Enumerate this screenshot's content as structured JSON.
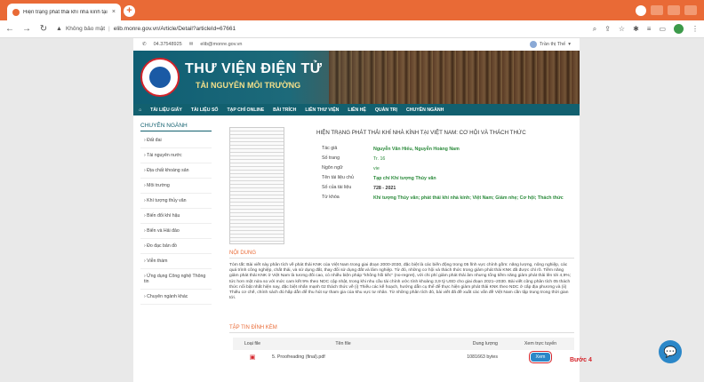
{
  "browser": {
    "tab_title": "Hiện trạng phát thải khí nhà kính tại V",
    "tab_close": "×",
    "new_tab": "+",
    "url_security": "Không bảo mật",
    "url_path": "elib.monre.gov.vn/Article/Detail?articleId=67661"
  },
  "topline": {
    "phone": "04.37548925",
    "email": "elib@monre.gov.vn",
    "user": "Trần thị Thế"
  },
  "banner": {
    "title": "THƯ VIỆN ĐIỆN TỬ",
    "subtitle": "TÀI NGUYÊN MÔI TRƯỜNG"
  },
  "nav": [
    "TÀI LIỆU GIẤY",
    "TÀI LIỆU SỐ",
    "TẠP CHÍ ONLINE",
    "BÀI TRÍCH",
    "LIÊN THƯ VIỆN",
    "LIÊN HỆ",
    "QUẢN TRỊ",
    "CHUYÊN NGÀNH"
  ],
  "sidebar": {
    "title": "CHUYÊN NGÀNH",
    "items": [
      "Đất đai",
      "Tài nguyên nước",
      "Địa chất khoáng sản",
      "Môi trường",
      "Khí tượng thủy văn",
      "Biến đổi khí hậu",
      "Biển và Hải đảo",
      "Đo đạc bản đồ",
      "Viễn thám",
      "Ứng dụng Công nghệ Thông tin",
      "Chuyên ngành khác"
    ]
  },
  "doc": {
    "title": "HIỆN TRẠNG PHÁT THẢI KHÍ NHÀ KÍNH TẠI VIỆT NAM: CƠ HỘI VÀ THÁCH THỨC",
    "meta": [
      {
        "k": "Tác giả",
        "v": "Nguyễn Văn Hiếu, Nguyễn Hoàng Nam"
      },
      {
        "k": "Số trang",
        "v": "Tr. 16"
      },
      {
        "k": "Ngôn ngữ",
        "v": "vie"
      },
      {
        "k": "Tên tài liệu chủ",
        "v": "Tạp chí Khí tượng Thủy văn"
      },
      {
        "k": "Số của tài liệu",
        "v": "728 - 2021"
      },
      {
        "k": "Từ khóa",
        "v": "Khí tượng Thủy văn; phát thải khí nhà kính; Việt Nam; Giảm nhẹ; Cơ hội; Thách thức"
      }
    ]
  },
  "content_heading": "NỘI DUNG",
  "abstract": "Tóm tắt: Bài viết này phân tích về phát thải KNK của Việt Nam trong giai đoạn 2000-2030, đặc biệt là các biến động trong 05 lĩnh vực chính gồm: năng lượng, nông nghiệp, các quá trình công nghiệp, chất thải, và sử dụng đất, thay đổi sử dụng đất và lâm nghiệp. Từ đó, những cơ hội và thách thức trong giảm phát thải KNK đã được chỉ rõ. Tiềm năng giảm phát thải KNK ở Việt Nam là tương đối cao, có nhiều biện pháp \"không hối tiếc\" (no-regret), với chi phí giảm phát thải âm nhưng tổng tiềm năng giảm phát thải lên tới 4,9%; tức hơn một nửa so với mức cam kết 9% theo NDC cập nhật, trong khi nhu cầu tài chính ước tính khoảng 3,9 tỷ USD cho giai đoạn 2021–2030. Bài viết cũng phân tích 05 thách thức nổi bật nhất hiện nay, đặc biệt nhấn mạnh 02 thách thức về (i) Thiếu các kế hoạch, hướng dẫn cụ thể để thực hiện giảm phát thải KNK theo NDC ở cấp địa phương và (ii) Thiếu cơ chế, chính sách đủ hấp dẫn để thu hút sự tham gia của khu vực tư nhân. Từ những phân tích đó, bài viết đã đề xuất các vấn đề Việt Nam cần tập trung trong thời gian tới.",
  "files": {
    "heading": "TẬP TIN ĐÍNH KÈM",
    "columns": [
      "Loại file",
      "Tên file",
      "Dung lượng",
      "Xem trực tuyến"
    ],
    "rows": [
      {
        "name": "5. Proofreading (final).pdf",
        "size": "1081663 bytes",
        "action": "Xem"
      }
    ]
  },
  "annotation": "Bước 4"
}
